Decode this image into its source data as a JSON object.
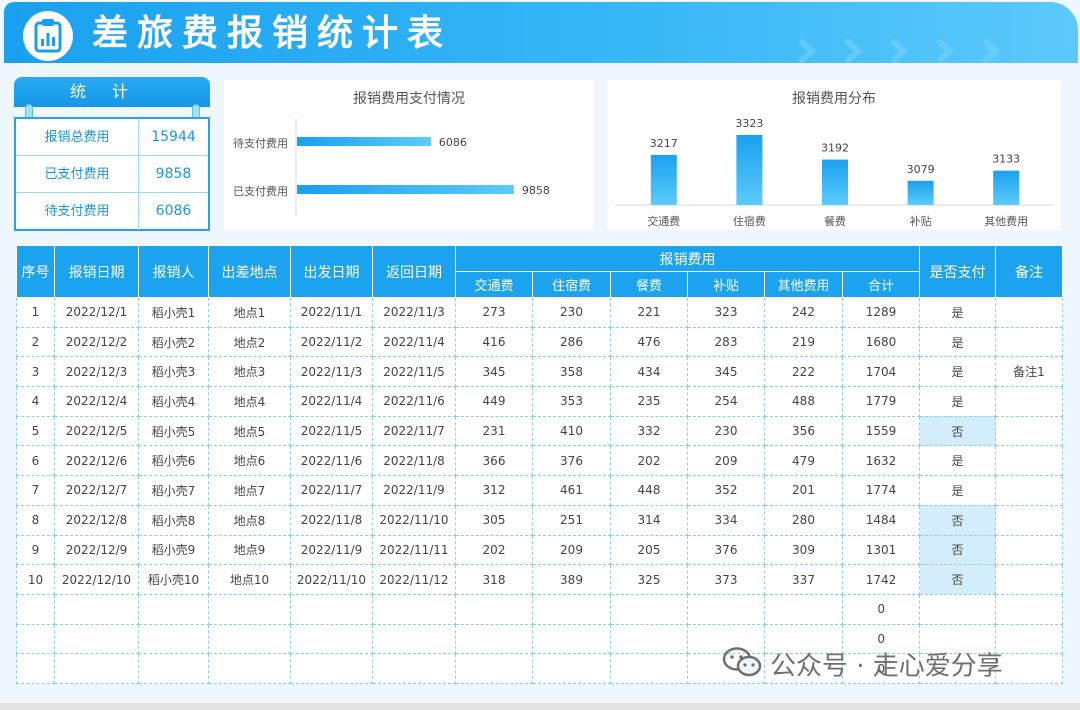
{
  "header": {
    "title": "差旅费报销统计表",
    "logo_icon": "clipboard-chart-icon"
  },
  "stats": {
    "title": "统计",
    "rows": [
      {
        "label": "报销总费用",
        "value": "15944"
      },
      {
        "label": "已支付费用",
        "value": "9858"
      },
      {
        "label": "待支付费用",
        "value": "6086"
      }
    ]
  },
  "payment_chart": {
    "title": "报销费用支付情况",
    "chart_data": {
      "type": "bar",
      "orientation": "horizontal",
      "categories": [
        "待支付费用",
        "已支付费用"
      ],
      "values": [
        6086,
        9858
      ],
      "title": "报销费用支付情况",
      "color": "#1ba3ef"
    }
  },
  "distribution_chart": {
    "title": "报销费用分布",
    "chart_data": {
      "type": "bar",
      "categories": [
        "交通费",
        "住宿费",
        "餐费",
        "补贴",
        "其他费用"
      ],
      "values": [
        3217,
        3323,
        3192,
        3079,
        3133
      ],
      "title": "报销费用分布",
      "color": "#1ba3ef"
    }
  },
  "table": {
    "headers": {
      "seq": "序号",
      "date": "报销日期",
      "person": "报销人",
      "place": "出差地点",
      "depart": "出发日期",
      "return": "返回日期",
      "fees": "报销费用",
      "paid": "是否支付",
      "note": "备注"
    },
    "fee_headers": [
      "交通费",
      "住宿费",
      "餐费",
      "补贴",
      "其他费用",
      "合计"
    ],
    "rows": [
      [
        "1",
        "2022/12/1",
        "稻小壳1",
        "地点1",
        "2022/11/1",
        "2022/11/3",
        "273",
        "230",
        "221",
        "323",
        "242",
        "1289",
        "是",
        ""
      ],
      [
        "2",
        "2022/12/2",
        "稻小壳2",
        "地点2",
        "2022/11/2",
        "2022/11/4",
        "416",
        "286",
        "476",
        "283",
        "219",
        "1680",
        "是",
        ""
      ],
      [
        "3",
        "2022/12/3",
        "稻小壳3",
        "地点3",
        "2022/11/3",
        "2022/11/5",
        "345",
        "358",
        "434",
        "345",
        "222",
        "1704",
        "是",
        "备注1"
      ],
      [
        "4",
        "2022/12/4",
        "稻小壳4",
        "地点4",
        "2022/11/4",
        "2022/11/6",
        "449",
        "353",
        "235",
        "254",
        "488",
        "1779",
        "是",
        ""
      ],
      [
        "5",
        "2022/12/5",
        "稻小壳5",
        "地点5",
        "2022/11/5",
        "2022/11/7",
        "231",
        "410",
        "332",
        "230",
        "356",
        "1559",
        "否",
        ""
      ],
      [
        "6",
        "2022/12/6",
        "稻小壳6",
        "地点6",
        "2022/11/6",
        "2022/11/8",
        "366",
        "376",
        "202",
        "209",
        "479",
        "1632",
        "是",
        ""
      ],
      [
        "7",
        "2022/12/7",
        "稻小壳7",
        "地点7",
        "2022/11/7",
        "2022/11/9",
        "312",
        "461",
        "448",
        "352",
        "201",
        "1774",
        "是",
        ""
      ],
      [
        "8",
        "2022/12/8",
        "稻小壳8",
        "地点8",
        "2022/11/8",
        "2022/11/10",
        "305",
        "251",
        "314",
        "334",
        "280",
        "1484",
        "否",
        ""
      ],
      [
        "9",
        "2022/12/9",
        "稻小壳9",
        "地点9",
        "2022/11/9",
        "2022/11/11",
        "202",
        "209",
        "205",
        "376",
        "309",
        "1301",
        "否",
        ""
      ],
      [
        "10",
        "2022/12/10",
        "稻小壳10",
        "地点10",
        "2022/11/10",
        "2022/11/12",
        "318",
        "389",
        "325",
        "373",
        "337",
        "1742",
        "否",
        ""
      ]
    ],
    "empty_totals": [
      "0",
      "0",
      "0"
    ]
  },
  "watermark": {
    "text": "公众号 · 走心爱分享",
    "icon": "wechat-icon"
  }
}
